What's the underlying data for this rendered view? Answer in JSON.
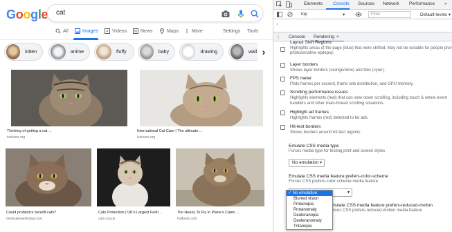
{
  "search": {
    "logo_letters": [
      {
        "ch": "G",
        "color": "#4285f4"
      },
      {
        "ch": "o",
        "color": "#ea4335"
      },
      {
        "ch": "o",
        "color": "#fbbc05"
      },
      {
        "ch": "g",
        "color": "#4285f4"
      },
      {
        "ch": "l",
        "color": "#34a853"
      },
      {
        "ch": "e",
        "color": "#ea4335"
      }
    ],
    "query": "cat",
    "icons": [
      "camera-icon",
      "mic-icon",
      "search-icon"
    ]
  },
  "tabs": {
    "all": "All",
    "images": "Images",
    "videos": "Videos",
    "news": "News",
    "maps": "Maps",
    "more": "More",
    "settings": "Settings",
    "tools": "Tools"
  },
  "chips": [
    "kitten",
    "anime",
    "fluffy",
    "baby",
    "drawing",
    "wall"
  ],
  "results": [
    {
      "caption": "Thinking of getting a cat ...",
      "source": "icatcare.org"
    },
    {
      "caption": "International Cat Care | The ultimate ...",
      "source": "icatcare.org"
    },
    {
      "caption": "Could probiotics benefit cats?",
      "source": "medicalnewstoday.com"
    },
    {
      "caption": "Cats Protection | UK's Largest Felin...",
      "source": "cats.org.uk"
    },
    {
      "caption": "Too Heavy To Fly In Plane's Cabin ...",
      "source": "huffpost.com"
    }
  ],
  "devtools": {
    "tabs": [
      "Elements",
      "Console",
      "Sources",
      "Network",
      "Performance"
    ],
    "more": "»",
    "context": "top",
    "filter_placeholder": "Filter",
    "levels": "Default levels ▾",
    "drawer_tabs": [
      "Console",
      "Rendering"
    ],
    "drawer_close": "×",
    "rendering": {
      "items": [
        {
          "title": "Layout Shift Regions",
          "desc": [
            "Highlights areas of the page (blue) that were shifted. May not be suitable for people prone to",
            "photosensitive epilepsy."
          ]
        },
        {
          "title": "Layer borders",
          "desc": [
            "Shows layer borders (orange/olive) and tiles (cyan)."
          ]
        },
        {
          "title": "FPS meter",
          "desc": [
            "Plots frames per second, frame rate distribution, and GPU memory."
          ]
        },
        {
          "title": "Scrolling performance issues",
          "desc": [
            "Highlights elements (teal) that can slow down scrolling, including touch & wheel event",
            "handlers and other main-thread scrolling situations."
          ]
        },
        {
          "title": "Highlight ad frames",
          "desc": [
            "Highlights frames (red) detected to be ads."
          ]
        },
        {
          "title": "Hit-test borders",
          "desc": [
            "Shows borders around hit-test regions."
          ]
        }
      ],
      "media_type_title": "Emulate CSS media type",
      "media_type_desc": "Forces media type for testing print and screen styles",
      "media_type_value": "No emulation",
      "color_scheme_title": "Emulate CSS media feature prefers-color-scheme",
      "color_scheme_desc": "Forces CSS prefers-color-scheme media feature",
      "reduced_motion_title": "Emulate CSS media feature prefers-reduced-motion",
      "reduced_motion_desc": "Forces CSS prefers-reduced-motion media feature",
      "vision_options": [
        "✓ No emulation",
        "Blurred vision",
        "Protanopia",
        "Protanomaly",
        "Deuteranopia",
        "Deuteranomaly",
        "Tritanopia"
      ]
    }
  },
  "colors": {
    "accent": "#1a73e8",
    "chip_bg": "#f1f3f4"
  }
}
